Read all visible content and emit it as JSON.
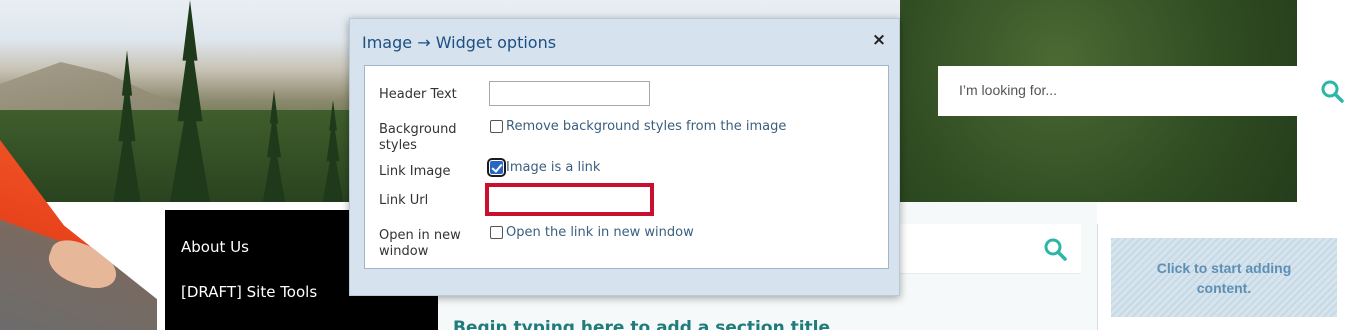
{
  "search": {
    "placeholder": "I’m looking for...",
    "icon": "search-icon"
  },
  "nav": {
    "items": [
      {
        "label": "About Us"
      },
      {
        "label": "[DRAFT] Site Tools"
      }
    ]
  },
  "content": {
    "section_title": "Begin typing here to add a section title",
    "add_content_label": "Click to start adding content.",
    "search_icon": "search-icon"
  },
  "dialog": {
    "title": "Image → Widget options",
    "close_glyph": "×",
    "fields": {
      "header_text": {
        "label": "Header Text",
        "value": ""
      },
      "background_styles": {
        "label": "Background styles",
        "checkbox_label": "Remove background styles from the image",
        "checked": false
      },
      "link_image": {
        "label": "Link Image",
        "checkbox_label": "Image is a link",
        "checked": true
      },
      "link_url": {
        "label": "Link Url",
        "value": ""
      },
      "open_new_window": {
        "label": "Open in new window",
        "checkbox_label": "Open the link in new window",
        "checked": false
      }
    }
  },
  "colors": {
    "accent_teal": "#2bb6a8",
    "dialog_title": "#1d4f84",
    "highlight_red": "#c8102e"
  }
}
